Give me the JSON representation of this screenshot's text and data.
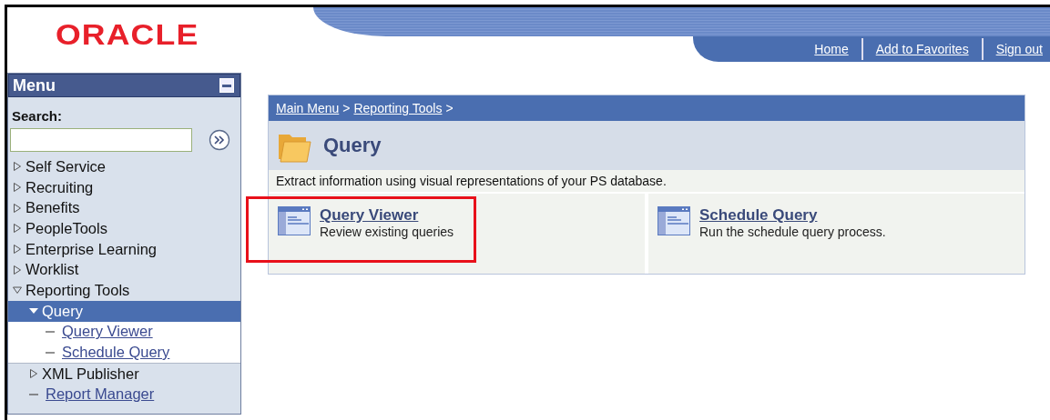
{
  "logo": {
    "text": "ORACLE"
  },
  "nav_links": [
    "Home",
    "Add to Favorites",
    "Sign out"
  ],
  "menu": {
    "title": "Menu",
    "search_label": "Search:",
    "items": [
      {
        "label": "Self Service",
        "kind": "folder",
        "expanded": false,
        "selected": false
      },
      {
        "label": "Recruiting",
        "kind": "folder",
        "expanded": false,
        "selected": false
      },
      {
        "label": "Benefits",
        "kind": "folder",
        "expanded": false,
        "selected": false
      },
      {
        "label": "PeopleTools",
        "kind": "folder",
        "expanded": false,
        "selected": false
      },
      {
        "label": "Enterprise Learning",
        "kind": "folder",
        "expanded": false,
        "selected": false
      },
      {
        "label": "Worklist",
        "kind": "folder",
        "expanded": false,
        "selected": false
      },
      {
        "label": "Reporting Tools",
        "kind": "folder",
        "expanded": true,
        "selected": false,
        "children": [
          {
            "label": "Query",
            "kind": "folder",
            "expanded": true,
            "selected": true,
            "children": [
              {
                "label": "Query Viewer",
                "kind": "link",
                "selected": false
              },
              {
                "label": "Schedule Query",
                "kind": "link",
                "selected": false
              }
            ]
          },
          {
            "label": "XML Publisher",
            "kind": "folder",
            "expanded": false,
            "selected": false
          },
          {
            "label": "Report Manager",
            "kind": "link",
            "selected": false
          }
        ]
      }
    ]
  },
  "content": {
    "breadcrumb": [
      {
        "label": "Main Menu",
        "separator": ">"
      },
      {
        "label": "Reporting Tools",
        "separator": ">"
      }
    ],
    "title": "Query",
    "description": "Extract information using visual representations of your PS database.",
    "cards": [
      {
        "title": "Query Viewer",
        "description": "Review existing queries",
        "highlighted": true
      },
      {
        "title": "Schedule Query",
        "description": "Run the schedule query process.",
        "highlighted": false
      }
    ]
  }
}
